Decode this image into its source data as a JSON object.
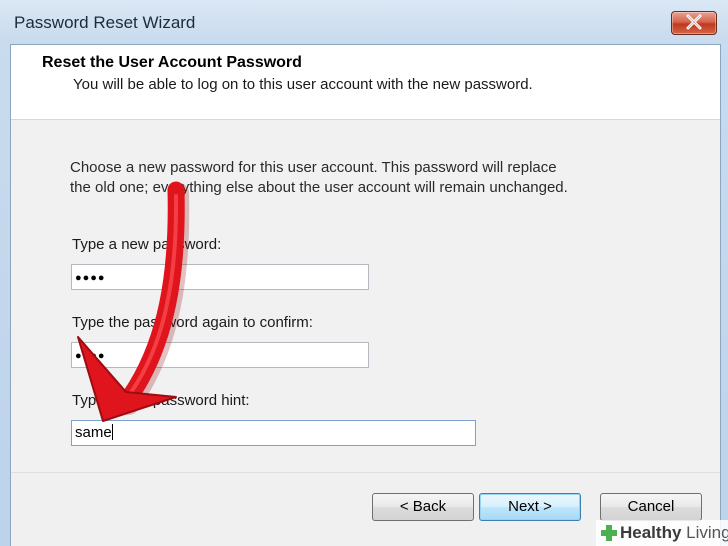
{
  "window": {
    "title": "Password Reset Wizard",
    "close_icon": "close-icon"
  },
  "header": {
    "title": "Reset the User Account Password",
    "subtitle": "You will be able to log on to this user account with the new password."
  },
  "body": {
    "intro_line1": "Choose a new password for this user account. This password will replace",
    "intro_line2": "the old one; everything else about the user account will remain unchanged.",
    "new_password_label": "Type a new password:",
    "new_password_value": "●●●●",
    "confirm_label": "Type the password again to confirm:",
    "confirm_value": "●●●●",
    "hint_label": "Type a new password hint:",
    "hint_value": "same"
  },
  "buttons": {
    "back": "< Back",
    "next": "Next >",
    "cancel": "Cancel"
  },
  "watermark": {
    "brand_bold": "Healthy",
    "brand_light": " Living"
  },
  "colors": {
    "arrow": "#e0141c",
    "watermark_cross": "#4caf50"
  }
}
